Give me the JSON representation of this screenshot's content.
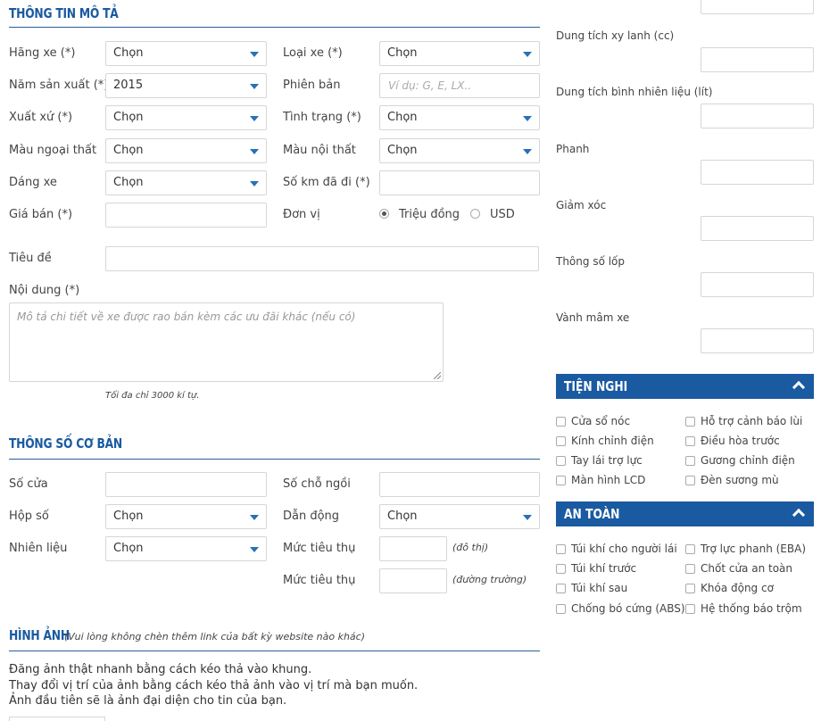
{
  "sections": {
    "mo_ta": "THÔNG TIN MÔ TẢ",
    "co_ban": "THÔNG SỐ CƠ BẢN",
    "hinh_anh": "HÌNH ẢNH",
    "hinh_anh_note": "(Vui lòng không chèn thêm link của bất kỳ website nào khác)"
  },
  "mo_ta": {
    "hang_xe_label": "Hãng xe (*)",
    "hang_xe_value": "Chọn",
    "loai_xe_label": "Loại xe (*)",
    "loai_xe_value": "Chọn",
    "nam_sx_label": "Năm sản xuất (*)",
    "nam_sx_value": "2015",
    "phien_ban_label": "Phiên bản",
    "phien_ban_placeholder": "Ví dụ: G, E, LX..",
    "xuat_xu_label": "Xuất xứ (*)",
    "xuat_xu_value": "Chọn",
    "tinh_trang_label": "Tình trạng (*)",
    "tinh_trang_value": "Chọn",
    "mau_ngoai_label": "Màu ngoại thất",
    "mau_ngoai_value": "Chọn",
    "mau_noi_label": "Màu nội thất",
    "mau_noi_value": "Chọn",
    "dang_xe_label": "Dáng xe",
    "dang_xe_value": "Chọn",
    "so_km_label": "Số km đã đi (*)",
    "gia_ban_label": "Giá bán (*)",
    "don_vi_label": "Đơn vị",
    "don_vi_option1": "Triệu đồng",
    "don_vi_option2": "USD",
    "tieu_de_label": "Tiêu đề",
    "noi_dung_label": "Nội dung (*)",
    "noi_dung_placeholder": "Mô tả chi tiết về xe được rao bán kèm các ưu đãi khác (nếu có)",
    "max_note": "Tối đa chỉ 3000 kí tự."
  },
  "co_ban": {
    "so_cua_label": "Số cửa",
    "so_cho_label": "Số chỗ ngồi",
    "hop_so_label": "Hộp số",
    "hop_so_value": "Chọn",
    "dan_dong_label": "Dẫn động",
    "dan_dong_value": "Chọn",
    "nhien_lieu_label": "Nhiên liệu",
    "nhien_lieu_value": "Chọn",
    "muc_tieu_thu_label1": "Mức tiêu thụ",
    "unit_do_thi": "(đô thị)",
    "muc_tieu_thu_label2": "Mức tiêu thụ",
    "unit_duong_truong": "(đường trường)"
  },
  "hinh_anh": {
    "line1": "Đăng ảnh thật nhanh bằng cách kéo thả vào khung.",
    "line2": "Thay đổi vị trí của ảnh bằng cách kéo thả ảnh vào vị trí mà bạn muốn.",
    "line3": "Ảnh đầu tiên sẽ là ảnh đại diện cho tin của bạn."
  },
  "right": {
    "dung_tich_xy_lanh": "Dung tích xy lanh (cc)",
    "dung_tich_binh": "Dung tích bình nhiên liệu (lít)",
    "phanh": "Phanh",
    "giam_xoc": "Giảm xóc",
    "thong_so_lop": "Thông số lốp",
    "vanh_mam": "Vành mâm xe"
  },
  "tien_nghi": {
    "title": "TIỆN NGHI",
    "items": [
      "Cửa sổ nóc",
      "Hỗ trợ cảnh báo lùi",
      "Kính chỉnh điện",
      "Điều hòa trước",
      "Tay lái trợ lực",
      "Gương chỉnh điện",
      "Màn hình LCD",
      "Đèn sương mù"
    ]
  },
  "an_toan": {
    "title": "AN TOÀN",
    "items": [
      "Túi khí cho người lái",
      "Trợ lực phanh (EBA)",
      "Túi khí trước",
      "Chốt cửa an toàn",
      "Túi khí sau",
      "Khóa động cơ",
      "Chống bó cứng (ABS)",
      "Hệ thống báo trộm"
    ]
  },
  "colors": {
    "accent": "#1a5aa0",
    "arrow": "#2a6fb8"
  }
}
